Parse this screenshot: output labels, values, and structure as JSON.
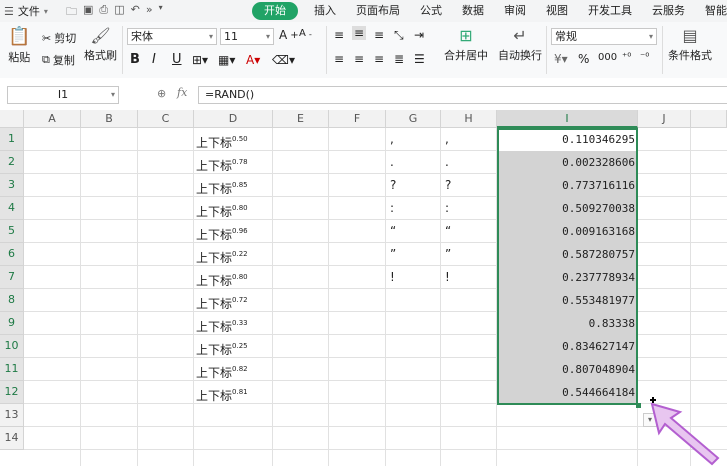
{
  "menu": {
    "file_label": "文件",
    "tabs": [
      "开始",
      "插入",
      "页面布局",
      "公式",
      "数据",
      "审阅",
      "视图",
      "开发工具",
      "云服务",
      "智能工具"
    ]
  },
  "ribbon": {
    "paste": "粘贴",
    "cut": "剪切",
    "copy": "复制",
    "format_painter": "格式刷",
    "font_name": "宋体",
    "font_size": "11",
    "bold": "B",
    "italic": "I",
    "underline": "U",
    "merge_center": "合并居中",
    "wrap_text": "自动换行",
    "number_format": "常规",
    "conditional_format": "条件格式"
  },
  "formula_bar": {
    "name_box": "I1",
    "fx": "fx",
    "formula": "=RAND()"
  },
  "columns": [
    "A",
    "B",
    "C",
    "D",
    "E",
    "F",
    "G",
    "H",
    "I",
    "J"
  ],
  "rows": [
    "1",
    "2",
    "3",
    "4",
    "5",
    "6",
    "7",
    "8",
    "9",
    "10",
    "11",
    "12",
    "13",
    "14"
  ],
  "selected_column": "I",
  "col_d": [
    {
      "text": "上下标",
      "sup": "0.50"
    },
    {
      "text": "上下标",
      "sup": "0.78"
    },
    {
      "text": "上下标",
      "sup": "0.85"
    },
    {
      "text": "上下标",
      "sup": "0.80"
    },
    {
      "text": "上下标",
      "sup": "0.96"
    },
    {
      "text": "上下标",
      "sup": "0.22"
    },
    {
      "text": "上下标",
      "sup": "0.80"
    },
    {
      "text": "上下标",
      "sup": "0.72"
    },
    {
      "text": "上下标",
      "sup": "0.33"
    },
    {
      "text": "上下标",
      "sup": "0.25"
    },
    {
      "text": "上下标",
      "sup": "0.82"
    },
    {
      "text": "上下标",
      "sup": "0.81"
    }
  ],
  "col_g": [
    ",",
    ".",
    "?",
    ":",
    "“",
    "”",
    "!"
  ],
  "col_h": [
    ",",
    ".",
    "?",
    ":",
    "“",
    "”",
    "!"
  ],
  "col_i": [
    "0.110346295",
    "0.002328606",
    "0.773716116",
    "0.509270038",
    "0.009163168",
    "0.587280757",
    "0.237778934",
    "0.553481977",
    "0.83338",
    "0.834627147",
    "0.807048904",
    "0.544664184"
  ]
}
